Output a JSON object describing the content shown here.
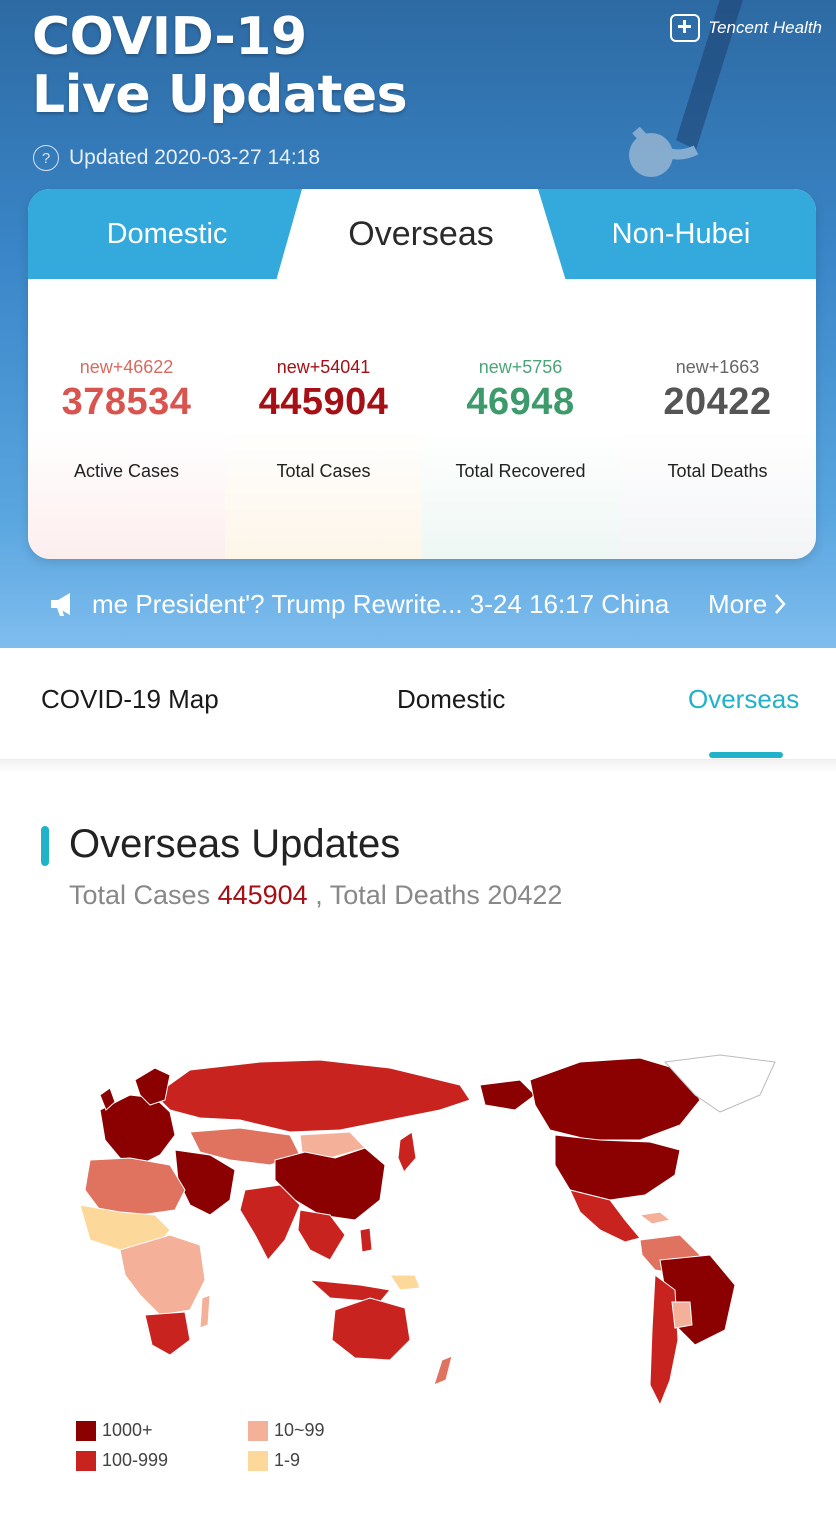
{
  "header": {
    "title_line1": "COVID-19",
    "title_line2": "Live Updates",
    "brand": "Tencent Health",
    "updated": "Updated 2020-03-27 14:18"
  },
  "tabs": [
    {
      "label": "Domestic",
      "active": false
    },
    {
      "label": "Overseas",
      "active": true
    },
    {
      "label": "Non-Hubei",
      "active": false
    }
  ],
  "stats": [
    {
      "new": "new+46622",
      "value": "378534",
      "label": "Active Cases"
    },
    {
      "new": "new+54041",
      "value": "445904",
      "label": "Total Cases"
    },
    {
      "new": "new+5756",
      "value": "46948",
      "label": "Total Recovered"
    },
    {
      "new": "new+1663",
      "value": "20422",
      "label": "Total Deaths"
    }
  ],
  "ticker": {
    "text": "me President'? Trump Rewrite... 3-24 16:17 China",
    "more": "More"
  },
  "nav": {
    "items": [
      "COVID-19 Map",
      "Domestic",
      "Overseas"
    ],
    "active": "Overseas"
  },
  "section": {
    "title": "Overseas Updates",
    "sub_prefix": "Total Cases",
    "total_cases": "445904",
    "sub_sep": ", Total Deaths",
    "total_deaths": "20422"
  },
  "legend": [
    {
      "label": "1000+",
      "color": "#8b0000"
    },
    {
      "label": "10~99",
      "color": "#f4b098"
    },
    {
      "label": "100-999",
      "color": "#c9231f"
    },
    {
      "label": "1-9",
      "color": "#fcd99a"
    }
  ],
  "colors": {
    "accent": "#1fb2c8",
    "tabbar": "#34a9dc",
    "dark_red": "#8b0000",
    "red": "#c9231f",
    "salmon": "#e0735f",
    "light": "#f4b098",
    "pale": "#fcd99a"
  }
}
